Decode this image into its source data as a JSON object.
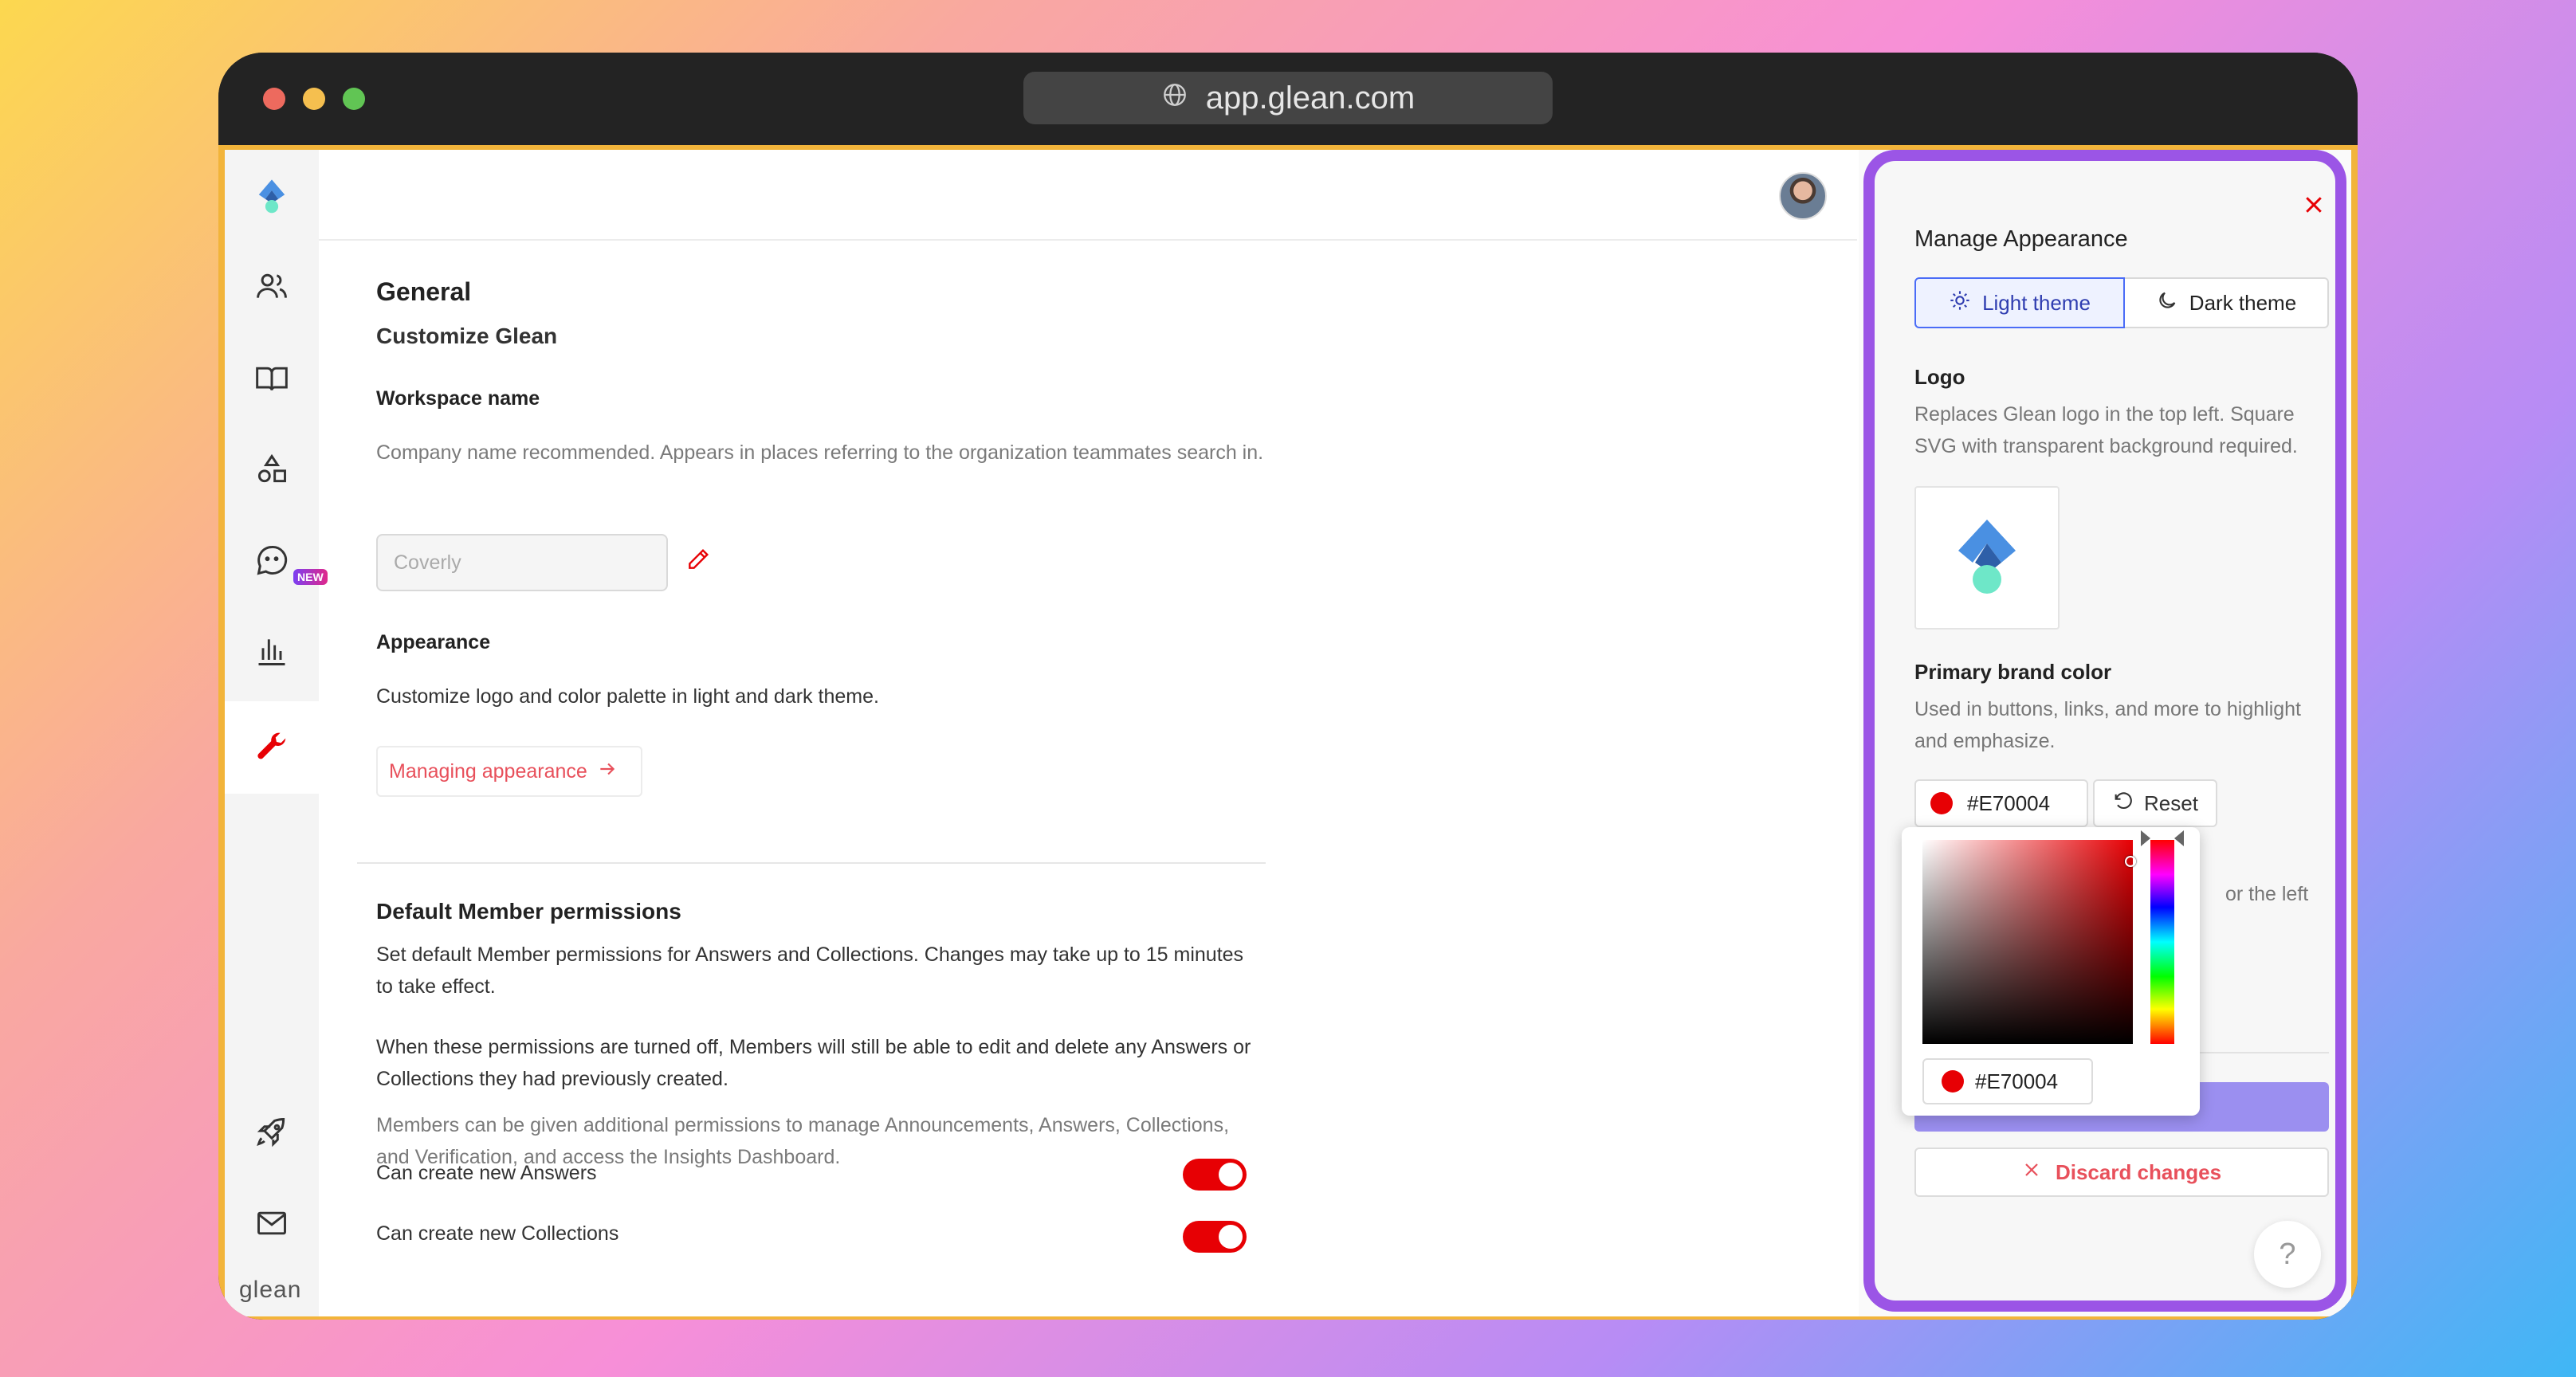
{
  "browser": {
    "url": "app.glean.com"
  },
  "sidebar": {
    "items": [
      {
        "icon": "people-icon"
      },
      {
        "icon": "book-icon"
      },
      {
        "icon": "shapes-icon"
      },
      {
        "icon": "chat-bot-icon",
        "badge": "NEW"
      },
      {
        "icon": "bar-chart-icon"
      },
      {
        "icon": "wrench-icon",
        "active": true
      }
    ],
    "bottom_items": [
      {
        "icon": "rocket-icon"
      },
      {
        "icon": "mail-icon"
      }
    ],
    "wordmark": "glean"
  },
  "main": {
    "title": "General",
    "section_title": "Customize Glean",
    "workspace": {
      "label": "Workspace name",
      "description": "Company name recommended. Appears in places referring to the organization teammates search in.",
      "placeholder": "Coverly"
    },
    "appearance": {
      "label": "Appearance",
      "description": "Customize logo and color palette in light and dark theme.",
      "link": "Managing appearance"
    },
    "permissions": {
      "title": "Default Member permissions",
      "description": "Set default Member permissions for Answers and Collections. Changes may take up to 15 minutes to take effect.",
      "note": "When these permissions are turned off, Members will still be able to edit and delete any Answers or Collections they had previously created.",
      "muted_note": "Members can be given additional permissions to manage Announcements, Answers, Collections, and Verification, and access the Insights Dashboard.",
      "toggles": [
        {
          "label": "Can create new Answers",
          "on": true
        },
        {
          "label": "Can create new Collections",
          "on": true
        }
      ]
    }
  },
  "panel": {
    "title": "Manage Appearance",
    "themes": [
      "Light theme",
      "Dark theme"
    ],
    "active_theme": "Light theme",
    "logo": {
      "label": "Logo",
      "description": "Replaces Glean logo in the top left. Square SVG with transparent background required."
    },
    "brand_color": {
      "label": "Primary brand color",
      "description": "Used in buttons, links, and more to highlight and emphasize.",
      "value": "#E70004",
      "reset_label": "Reset"
    },
    "partial_text": "or the left",
    "discard_label": "Discard changes",
    "help_label": "?"
  },
  "picker": {
    "value": "#E70004"
  },
  "colors": {
    "brand": "#E70004",
    "panel_border": "#9B55E6",
    "accent_link": "#E8505B",
    "active_theme": "#4A6CF7"
  }
}
